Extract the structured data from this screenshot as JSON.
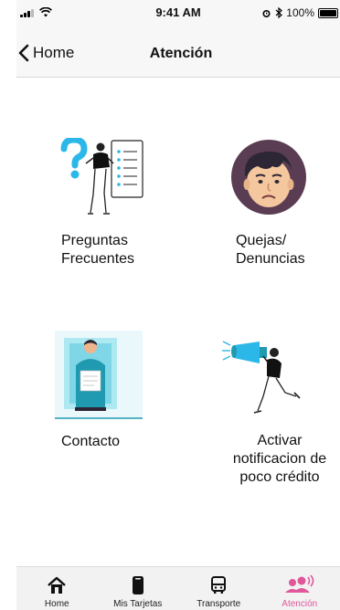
{
  "status_bar": {
    "time": "9:41 AM",
    "battery": "100%"
  },
  "nav": {
    "back_label": "Home",
    "title": "Atención"
  },
  "tiles": [
    {
      "label": "Preguntas\nFrecuentes",
      "icon": "faq-illustration"
    },
    {
      "label": "Quejas/\nDenuncias",
      "icon": "complaint-face-illustration"
    },
    {
      "label": "Contacto",
      "icon": "contact-illustration"
    },
    {
      "label": "Activar\nnotificacion de\npoco crédito",
      "icon": "megaphone-illustration"
    }
  ],
  "tabs": [
    {
      "label": "Home",
      "icon": "home-icon"
    },
    {
      "label": "Mis Tarjetas",
      "icon": "card-icon"
    },
    {
      "label": "Transporte",
      "icon": "bus-icon"
    },
    {
      "label": "Atención",
      "icon": "people-sound-icon",
      "active": true
    }
  ],
  "colors": {
    "accent": "#e0579a",
    "cyan": "#2bb8e8",
    "teal": "#1f9ab0",
    "face_bg": "#5a3d52"
  }
}
